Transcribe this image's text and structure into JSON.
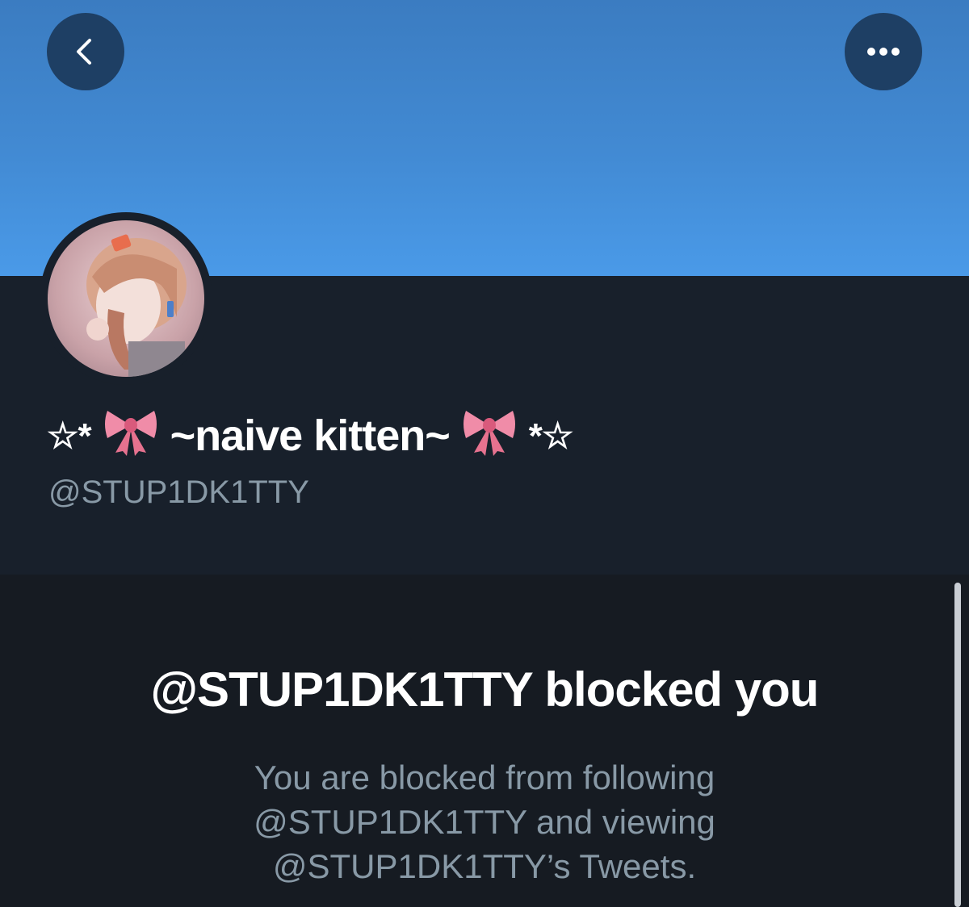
{
  "nav": {
    "back_icon": "chevron-left-icon",
    "more_icon": "ellipsis-icon"
  },
  "profile": {
    "display_name_prefix": "☆*",
    "display_name": "~naive kitten~",
    "display_name_suffix": "*☆",
    "bow_icon": "ribbon-bow-icon",
    "handle": "@STUP1DK1TTY"
  },
  "blocked": {
    "title": "@STUP1DK1TTY blocked you",
    "description": "You are blocked from following @STUP1DK1TTY and viewing @STUP1DK1TTY’s Tweets."
  },
  "colors": {
    "banner": "#428ad3",
    "background": "#18202b",
    "secondary_text": "#8899a6",
    "bow": "#f08ca8"
  }
}
